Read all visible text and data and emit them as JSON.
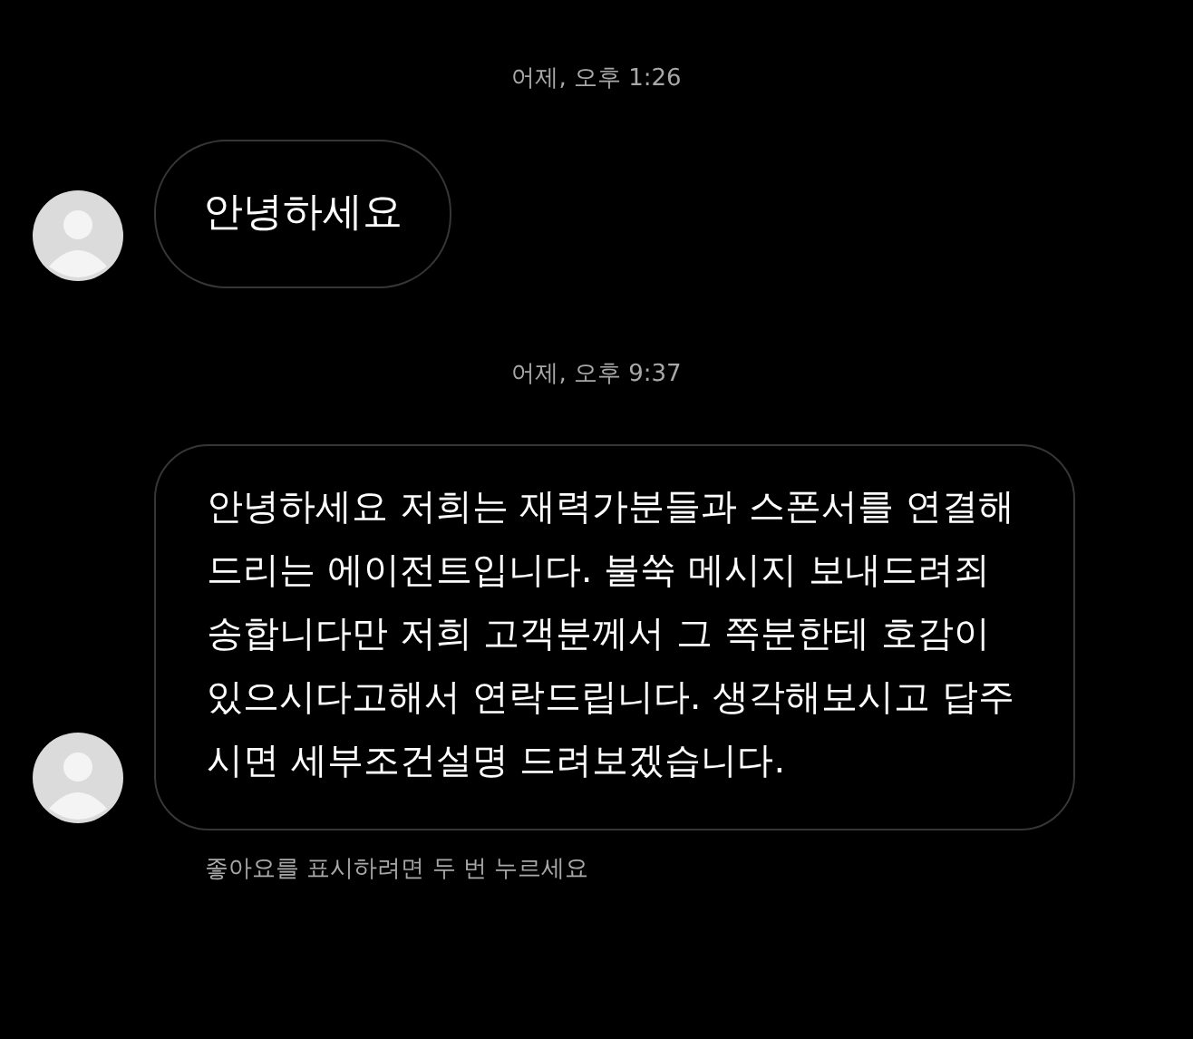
{
  "messages": [
    {
      "timestamp": "어제, 오후 1:26",
      "text": "안녕하세요"
    },
    {
      "timestamp": "어제, 오후 9:37",
      "text": "안녕하세요 저희는 재력가분들과 스폰서를 연결해드리는 에이전트입니다. 불쑥 메시지 보내드려죄송합니다만 저희 고객분께서 그 쪽분한테 호감이 있으시다고해서 연락드립니다. 생각해보시고 답주시면 세부조건설명 드려보겠습니다."
    }
  ],
  "hint": "좋아요를 표시하려면 두 번 누르세요"
}
